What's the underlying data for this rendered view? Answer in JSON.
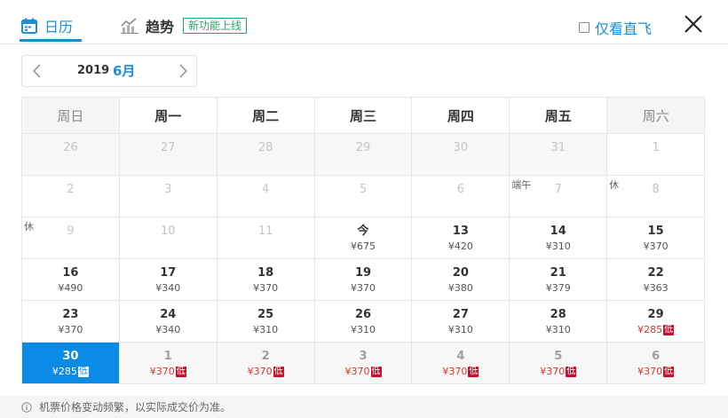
{
  "header": {
    "tab_calendar": "日历",
    "tab_trend": "趋势",
    "new_badge": "新功能上线",
    "direct_only": "仅看直飞"
  },
  "month_nav": {
    "year": "2019",
    "month": "6月"
  },
  "weekdays": [
    "周日",
    "周一",
    "周二",
    "周三",
    "周四",
    "周五",
    "周六"
  ],
  "weeks": [
    [
      {
        "day": "26",
        "state": "prevmonth"
      },
      {
        "day": "27",
        "state": "prevmonth"
      },
      {
        "day": "28",
        "state": "prevmonth"
      },
      {
        "day": "29",
        "state": "prevmonth"
      },
      {
        "day": "30",
        "state": "prevmonth"
      },
      {
        "day": "31",
        "state": "prevmonth"
      },
      {
        "day": "1",
        "state": "past"
      }
    ],
    [
      {
        "day": "2",
        "state": "past"
      },
      {
        "day": "3",
        "state": "past"
      },
      {
        "day": "4",
        "state": "past"
      },
      {
        "day": "5",
        "state": "past"
      },
      {
        "day": "6",
        "state": "past"
      },
      {
        "day": "7",
        "state": "past",
        "tag": "端午"
      },
      {
        "day": "8",
        "state": "past",
        "tag": "休"
      }
    ],
    [
      {
        "day": "9",
        "state": "past",
        "tag": "休"
      },
      {
        "day": "10",
        "state": "past"
      },
      {
        "day": "11",
        "state": "past"
      },
      {
        "day": "今",
        "state": "current",
        "price": "¥675"
      },
      {
        "day": "13",
        "state": "current",
        "price": "¥420"
      },
      {
        "day": "14",
        "state": "current",
        "price": "¥310"
      },
      {
        "day": "15",
        "state": "current",
        "price": "¥370"
      }
    ],
    [
      {
        "day": "16",
        "state": "current",
        "price": "¥490"
      },
      {
        "day": "17",
        "state": "current",
        "price": "¥340"
      },
      {
        "day": "18",
        "state": "current",
        "price": "¥370"
      },
      {
        "day": "19",
        "state": "current",
        "price": "¥370"
      },
      {
        "day": "20",
        "state": "current",
        "price": "¥380"
      },
      {
        "day": "21",
        "state": "current",
        "price": "¥379"
      },
      {
        "day": "22",
        "state": "current",
        "price": "¥363"
      }
    ],
    [
      {
        "day": "23",
        "state": "current",
        "price": "¥370"
      },
      {
        "day": "24",
        "state": "current",
        "price": "¥340"
      },
      {
        "day": "25",
        "state": "current",
        "price": "¥310"
      },
      {
        "day": "26",
        "state": "current",
        "price": "¥310"
      },
      {
        "day": "27",
        "state": "current",
        "price": "¥310"
      },
      {
        "day": "28",
        "state": "current",
        "price": "¥310"
      },
      {
        "day": "29",
        "state": "current",
        "price": "¥285",
        "low": "低"
      }
    ],
    [
      {
        "day": "30",
        "state": "selected",
        "price": "¥285",
        "low": "低"
      },
      {
        "day": "1",
        "state": "nextmonth",
        "price": "¥370",
        "low": "低"
      },
      {
        "day": "2",
        "state": "nextmonth",
        "price": "¥370",
        "low": "低"
      },
      {
        "day": "3",
        "state": "nextmonth",
        "price": "¥370",
        "low": "低"
      },
      {
        "day": "4",
        "state": "nextmonth",
        "price": "¥370",
        "low": "低"
      },
      {
        "day": "5",
        "state": "nextmonth",
        "price": "¥370",
        "low": "低"
      },
      {
        "day": "6",
        "state": "nextmonth",
        "price": "¥370",
        "low": "低"
      }
    ]
  ],
  "footer": {
    "note": "机票价格变动频繁，以实际成交价为准。"
  },
  "colors": {
    "accent": "#1a8fd6",
    "selected": "#0b8ae6",
    "low_price": "#e0322e",
    "low_badge": "#c8102e",
    "new_badge": "#2aa56b"
  },
  "icons": {
    "calendar": "calendar-icon",
    "trend": "trend-chart-icon",
    "close": "close-icon",
    "prev": "chevron-left-icon",
    "next": "chevron-right-icon",
    "info": "info-icon"
  }
}
